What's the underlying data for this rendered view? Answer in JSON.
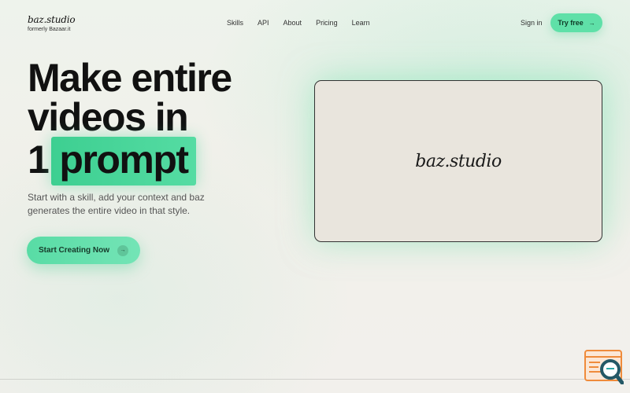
{
  "brand": {
    "name": "baz.studio",
    "tagline": "formerly Bazaar.it"
  },
  "nav": {
    "items": [
      "Skills",
      "API",
      "About",
      "Pricing",
      "Learn"
    ]
  },
  "header": {
    "signin_label": "Sign in",
    "tryfree_label": "Try free",
    "tryfree_icon": "arrow-right-icon"
  },
  "hero": {
    "line1": "Make entire",
    "line2": "videos in",
    "line3_prefix": "1",
    "line3_highlight": "prompt",
    "subtitle": "Start with a skill, add your context and baz generates the entire video in that style.",
    "cta_label": "Start Creating Now",
    "cta_icon": "arrow-right-icon"
  },
  "preview": {
    "logo": "baz.studio"
  },
  "colors": {
    "accent": "#5fe0a8",
    "highlight": "#3dcf91",
    "text": "#111111",
    "muted": "#555555"
  }
}
